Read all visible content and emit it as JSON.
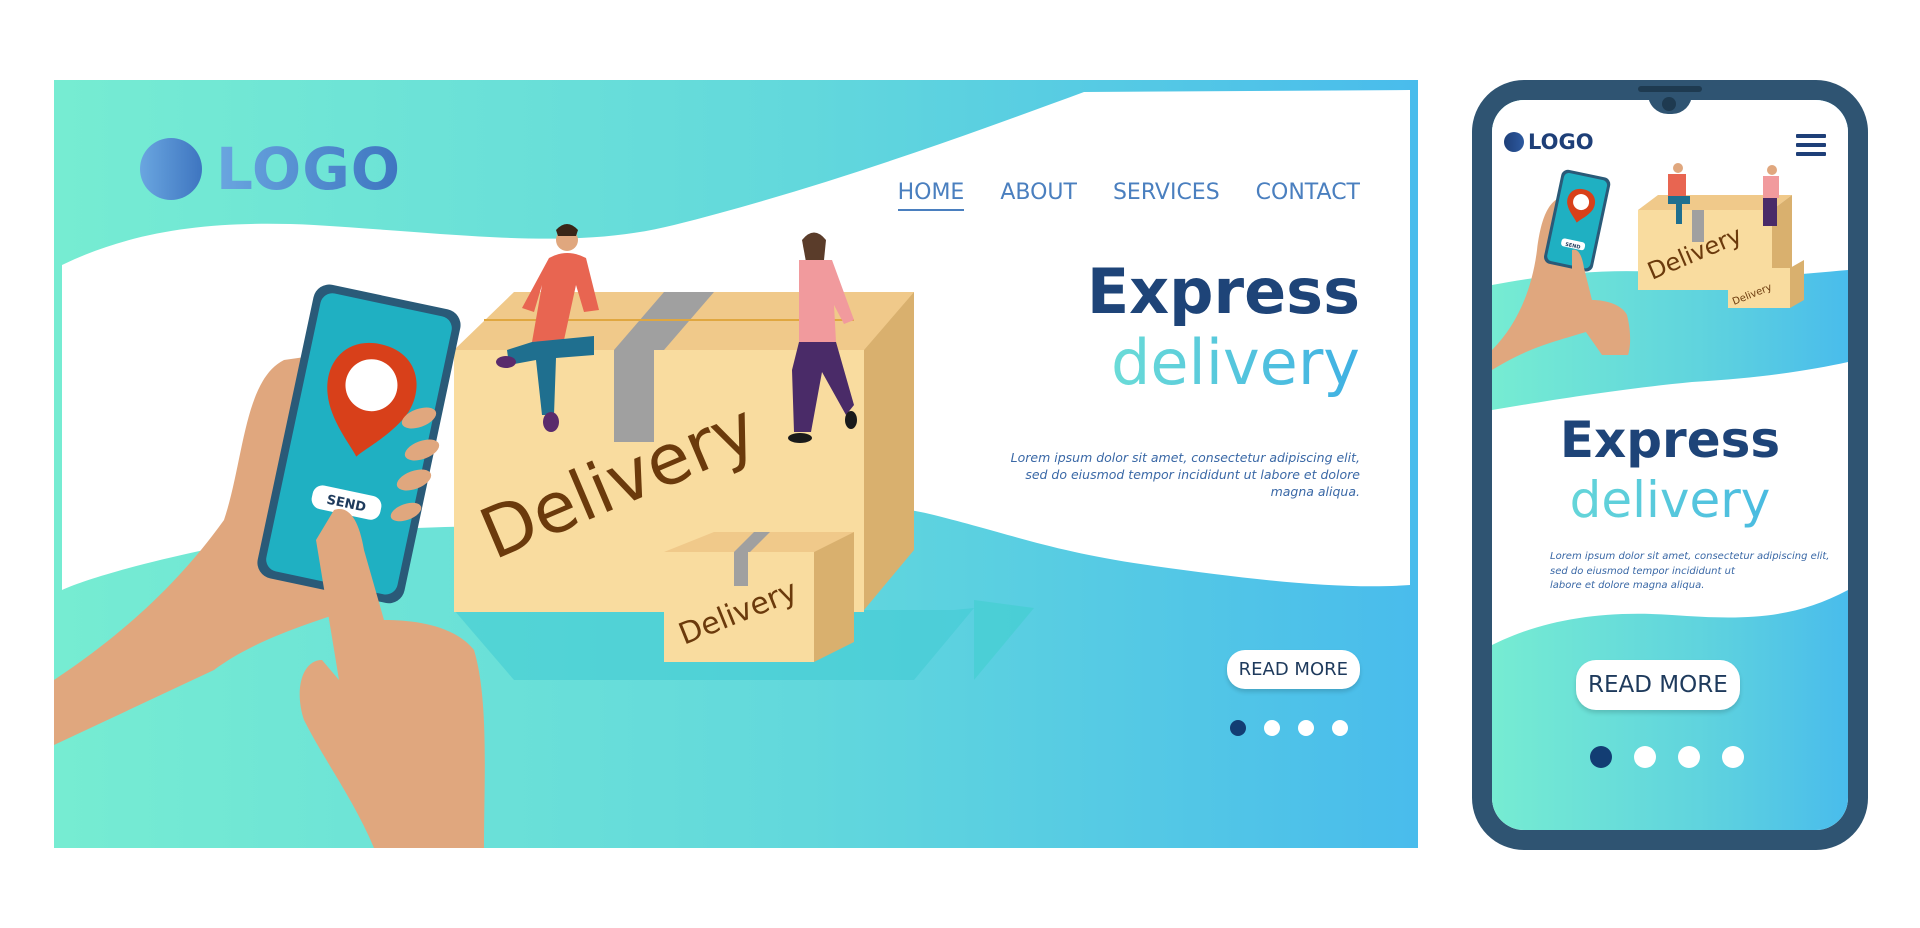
{
  "desktop": {
    "logo": {
      "text": "LOGO",
      "icon": "circle-logo-icon"
    },
    "nav": {
      "items": [
        {
          "label": "HOME",
          "active": true
        },
        {
          "label": "ABOUT",
          "active": false
        },
        {
          "label": "SERVICES",
          "active": false
        },
        {
          "label": "CONTACT",
          "active": false
        }
      ]
    },
    "hero": {
      "title_line1": "Express",
      "title_line2": "delivery",
      "description": "Lorem ipsum dolor sit amet, consectetur adipiscing elit, sed do eiusmod tempor incididunt ut labore et dolore magna aliqua.",
      "read_more_label": "READ MORE"
    },
    "illustration": {
      "phone_button_label": "SEND",
      "box_large_label": "Delivery",
      "box_small_label": "Delivery",
      "icons": [
        "map-pin-icon",
        "smartphone-icon",
        "hand-icon",
        "box-icon",
        "person-icon"
      ]
    },
    "carousel": {
      "total": 4,
      "active_index": 0
    }
  },
  "mobile": {
    "logo": {
      "text": "LOGO"
    },
    "menu_icon": "hamburger-menu-icon",
    "hero": {
      "title_line1": "Express",
      "title_line2": "delivery",
      "description_lines": [
        "Lorem ipsum dolor sit amet, consectetur adipiscing elit,",
        "sed do eiusmod tempor incididunt ut",
        "labore et dolore magna aliqua."
      ],
      "read_more_label": "READ MORE"
    },
    "illustration": {
      "phone_button_label": "SEND",
      "box_large_label": "Delivery",
      "box_small_label": "Delivery"
    },
    "carousel": {
      "total": 4,
      "active_index": 0
    }
  },
  "colors": {
    "teal": "#74ead2",
    "sky": "#4bbcec",
    "navy": "#1e4478",
    "link": "#4a7fbf",
    "box": "#f9dc9f",
    "box_side": "#d9b06e",
    "label_brown": "#6b3a0c",
    "skin": "#e0a77e",
    "phone_screen": "#1fb0c2",
    "pin_red": "#d8401a",
    "device_frame": "#2f5472"
  }
}
